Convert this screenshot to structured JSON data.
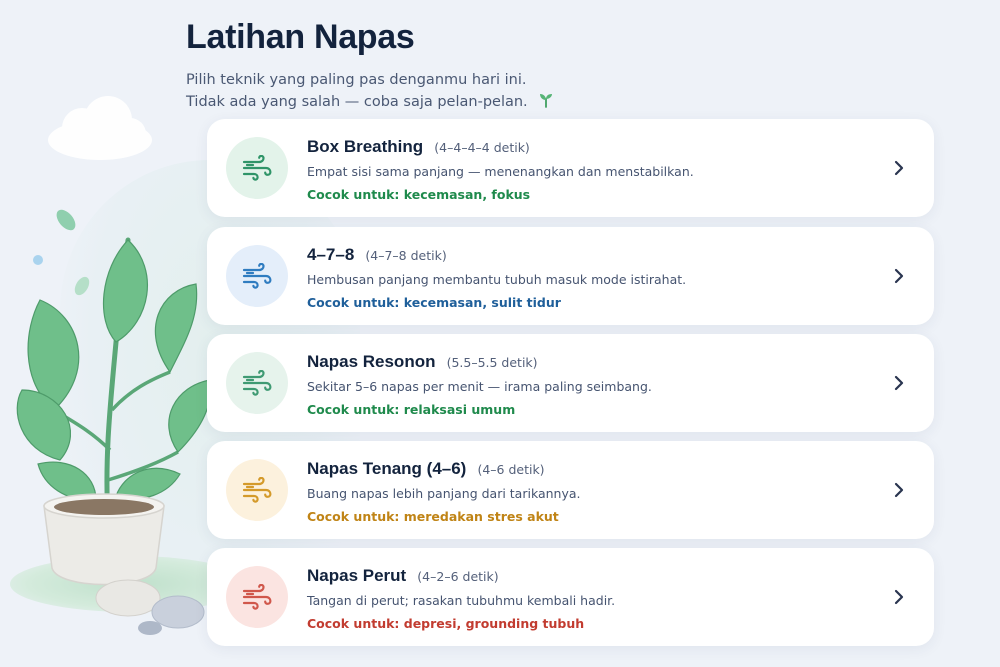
{
  "header": {
    "title": "Latihan Napas",
    "subtitle_line1": "Pilih teknik yang paling pas denganmu hari ini.",
    "subtitle_line2": "Tidak ada yang salah — coba saja pelan-pelan."
  },
  "cards": [
    {
      "title": "Box Breathing",
      "timing": "(4–4–4–4 detik)",
      "description": "Empat sisi sama panjang — menenangkan dan menstabilkan.",
      "tag": "Cocok untuk: kecemasan, fokus",
      "icon": "wind-icon",
      "accent": "#2f9468",
      "tag_color": "#1f8a4c",
      "icon_bg": "#e3f3ea"
    },
    {
      "title": "4–7–8",
      "timing": "(4–7–8 detik)",
      "description": "Hembusan panjang membantu tubuh masuk mode istirahat.",
      "tag": "Cocok untuk: kecemasan, sulit tidur",
      "icon": "wind-icon",
      "accent": "#2f7cc0",
      "tag_color": "#1f5f9a",
      "icon_bg": "#e4eefa"
    },
    {
      "title": "Napas Resonon",
      "timing": "(5.5–5.5 detik)",
      "description": "Sekitar 5–6 napas per menit — irama paling seimbang.",
      "tag": "Cocok untuk: relaksasi umum",
      "icon": "wind-icon",
      "accent": "#3f9a73",
      "tag_color": "#1f8a4c",
      "icon_bg": "#e6f3ec"
    },
    {
      "title": "Napas Tenang (4–6)",
      "timing": "(4–6 detik)",
      "description": "Buang napas lebih panjang dari tarikannya.",
      "tag": "Cocok untuk: meredakan stres akut",
      "icon": "wind-icon",
      "accent": "#d49a2a",
      "tag_color": "#c08416",
      "icon_bg": "#fcf1dd"
    },
    {
      "title": "Napas Perut",
      "timing": "(4–2–6 detik)",
      "description": "Tangan di perut; rasakan tubuhmu kembali hadir.",
      "tag": "Cocok untuk: depresi, grounding tubuh",
      "icon": "wind-icon",
      "accent": "#d0574b",
      "tag_color": "#c23c30",
      "icon_bg": "#fbe4e1"
    }
  ]
}
